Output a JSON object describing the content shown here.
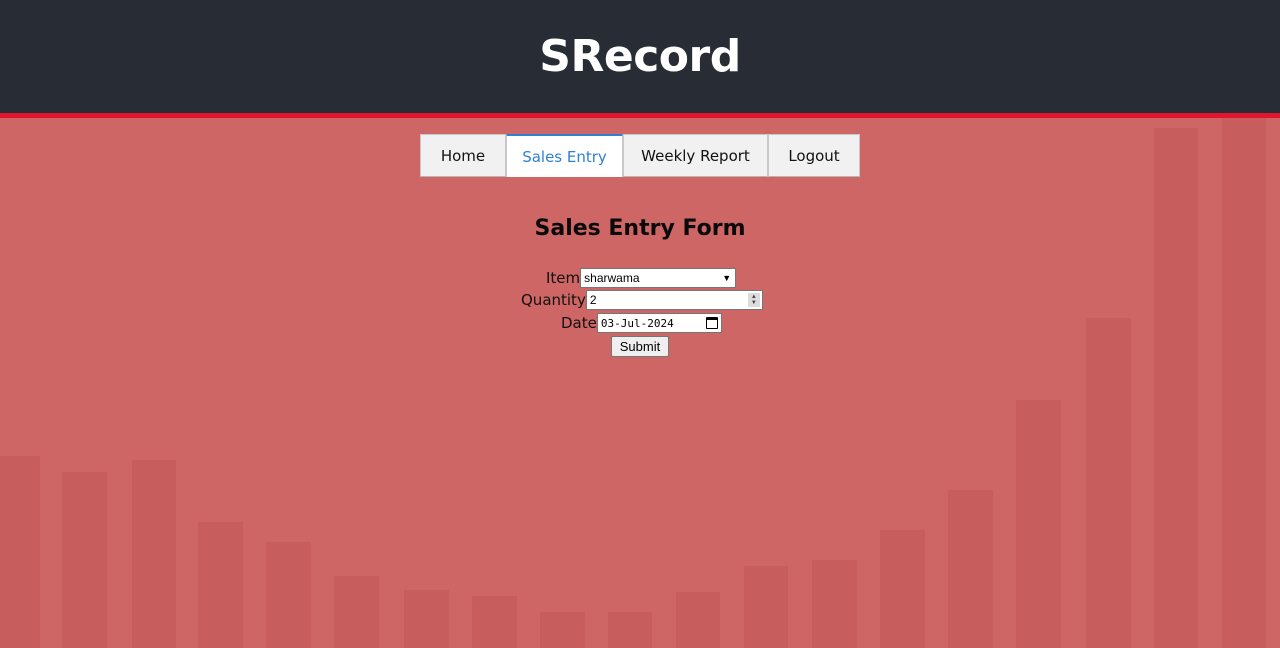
{
  "app": {
    "title": "SRecord"
  },
  "nav": {
    "tabs": [
      {
        "label": "Home",
        "active": false
      },
      {
        "label": "Sales Entry",
        "active": true
      },
      {
        "label": "Weekly Report",
        "active": false
      },
      {
        "label": "Logout",
        "active": false
      }
    ]
  },
  "form": {
    "title": "Sales Entry Form",
    "item": {
      "label": "Item",
      "value": "sharwama"
    },
    "quantity": {
      "label": "Quantity",
      "value": "2"
    },
    "date": {
      "label": "Date",
      "value": "03-Jul-2024"
    },
    "submit_label": "Submit"
  },
  "colors": {
    "header_bg": "#282c35",
    "header_accent": "#e0152f",
    "page_bg": "#cd6664",
    "active_tab": "#2f7fd6"
  },
  "icons": {
    "dropdown": "chevron-down-icon",
    "spinner": "spinner-arrows-icon",
    "calendar": "calendar-icon"
  }
}
